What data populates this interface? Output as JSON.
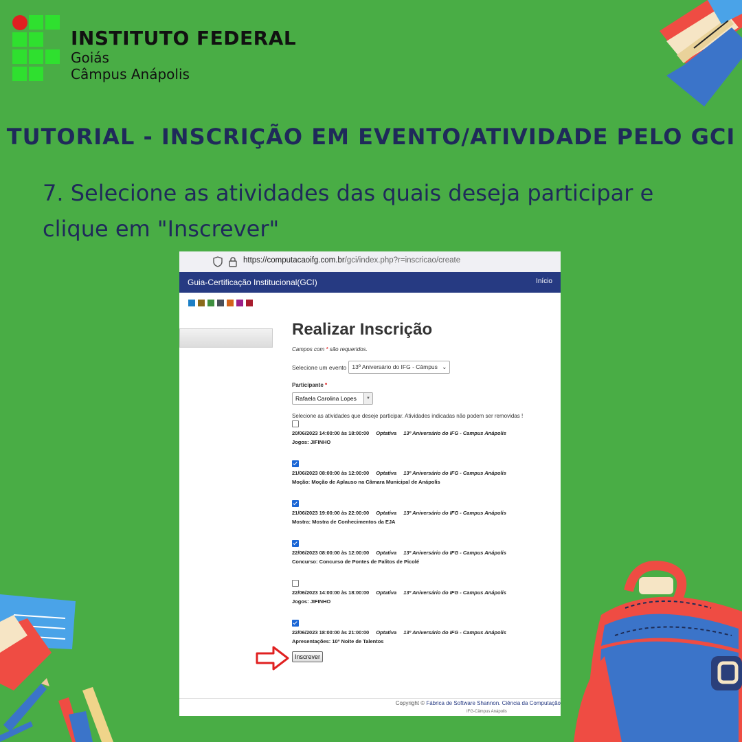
{
  "logo": {
    "line1": "INSTITUTO FEDERAL",
    "line2": "Goiás",
    "line3": "Câmpus Anápolis"
  },
  "heading": "TUTORIAL - INSCRIÇÃO EM EVENTO/ATIVIDADE PELO GCI",
  "instruction": "7. Selecione as atividades das quais deseja participar e clique em \"Inscrever\"",
  "browser": {
    "url_host": "https://computacaoifg.com.br",
    "url_path": "/gci/index.php?r=inscricao/create"
  },
  "app": {
    "nav_title": "Guia-Certificação Institucional(GCI)",
    "nav_home": "Início",
    "swatch_colors": [
      "#1c7fc6",
      "#8a6a1a",
      "#3f8f3f",
      "#4a4f5a",
      "#d4641c",
      "#9c1f8a",
      "#a81c2e"
    ]
  },
  "form": {
    "title": "Realizar Inscrição",
    "required_note_pre": "Campos com ",
    "required_star": "*",
    "required_note_post": " são requeridos.",
    "event_label": "Selecione um evento",
    "event_value": "13º Aniversário do IFG - Câmpus",
    "participant_label": "Participante",
    "participant_value": "Rafaela Carolina Lopes",
    "activities_instruction": "Selecione as atividades que deseje participar. Atividades indicadas não podem ser removidas !",
    "activities": [
      {
        "checked": false,
        "date": "20/06/2023 14:00:00 às 18:00:00",
        "type": "Optativa",
        "event": "13º Aniversário do IFG - Campus Anápolis",
        "title": "Jogos: JIFINHO"
      },
      {
        "checked": true,
        "date": "21/06/2023 08:00:00 às 12:00:00",
        "type": "Optativa",
        "event": "13º Aniversário do IFG - Campus Anápolis",
        "title": "Moção: Moção de Aplauso na Câmara Municipal de Anápolis"
      },
      {
        "checked": true,
        "date": "21/06/2023 19:00:00 às 22:00:00",
        "type": "Optativa",
        "event": "13º Aniversário do IFG - Campus Anápolis",
        "title": "Mostra: Mostra de Conhecimentos da EJA"
      },
      {
        "checked": true,
        "date": "22/06/2023 08:00:00 às 12:00:00",
        "type": "Optativa",
        "event": "13º Aniversário do IFG - Campus Anápolis",
        "title": "Concurso: Concurso de Pontes de Palitos de Picolé"
      },
      {
        "checked": false,
        "date": "22/06/2023 14:00:00 às 18:00:00",
        "type": "Optativa",
        "event": "13º Aniversário do IFG - Campus Anápolis",
        "title": "Jogos: JIFINHO"
      },
      {
        "checked": true,
        "date": "22/06/2023 18:00:00 às 21:00:00",
        "type": "Optativa",
        "event": "13º Aniversário do IFG - Campus Anápolis",
        "title": "Apresentações: 10º Noite de Talentos"
      }
    ],
    "submit_label": "Inscrever"
  },
  "footer": {
    "copyright": "Copyright © ",
    "link": "Fábrica de Software Shannon. Ciência da Computação",
    "sub": "IFG-Câmpus Anápolis"
  },
  "colors": {
    "background": "#49ad45",
    "heading": "#1f2a5a",
    "navbar": "#263a82",
    "arrow": "#e02020"
  }
}
